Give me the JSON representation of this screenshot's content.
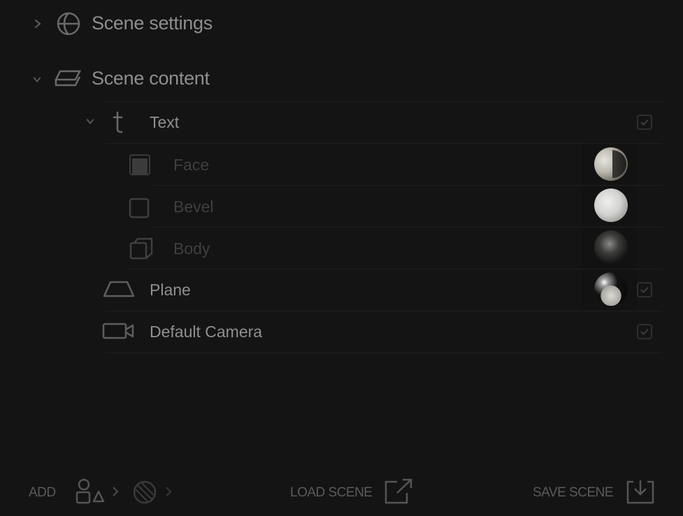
{
  "sections": {
    "settings": {
      "title": "Scene settings",
      "icon": "globe-icon",
      "expanded": false
    },
    "content": {
      "title": "Scene content",
      "icon": "layers-icon",
      "expanded": true
    }
  },
  "items": {
    "text": {
      "label": "Text",
      "icon": "text-tool-icon",
      "checked": true
    },
    "face": {
      "label": "Face",
      "icon": "face-square-icon"
    },
    "bevel": {
      "label": "Bevel",
      "icon": "bevel-square-icon"
    },
    "body": {
      "label": "Body",
      "icon": "body-cube-icon"
    },
    "plane": {
      "label": "Plane",
      "icon": "plane-icon",
      "checked": true
    },
    "camera": {
      "label": "Default Camera",
      "icon": "camera-icon",
      "checked": true
    }
  },
  "footer": {
    "add_label": "ADD",
    "load_label": "LOAD SCENE",
    "save_label": "SAVE SCENE"
  },
  "colors": {
    "background": "#141414",
    "title_text": "#8e8e8e",
    "dim_text": "#3f3f3f",
    "divider": "#1f1f1f"
  }
}
